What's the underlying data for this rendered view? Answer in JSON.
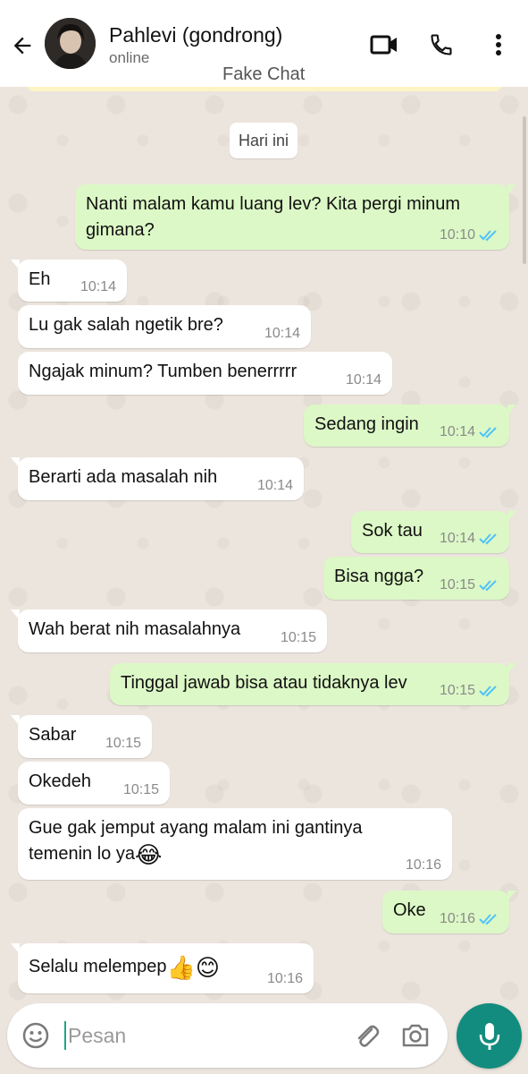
{
  "header": {
    "contact_name": "Pahlevi (gondrong)",
    "status": "online",
    "watermark": "Fake Chat",
    "icons": [
      "back-arrow-icon",
      "video-call-icon",
      "phone-icon",
      "more-vert-icon"
    ]
  },
  "chat": {
    "date_chip": "Hari ini",
    "messages": [
      {
        "dir": "out",
        "line1": "Nanti malam kamu luang lev? Kita pergi minum",
        "line2": "gimana?",
        "time": "10:10",
        "read": true
      },
      {
        "dir": "in",
        "text": "Eh",
        "time": "10:14"
      },
      {
        "dir": "in",
        "text": "Lu gak salah ngetik bre?",
        "time": "10:14"
      },
      {
        "dir": "in",
        "text": "Ngajak minum? Tumben benerrrrr",
        "time": "10:14"
      },
      {
        "dir": "out",
        "text": "Sedang ingin",
        "time": "10:14",
        "read": true
      },
      {
        "dir": "in",
        "text": "Berarti ada masalah nih",
        "time": "10:14"
      },
      {
        "dir": "out",
        "text": "Sok tau",
        "time": "10:14",
        "read": true
      },
      {
        "dir": "out",
        "text": "Bisa ngga?",
        "time": "10:15",
        "read": true
      },
      {
        "dir": "in",
        "text": "Wah berat nih masalahnya",
        "time": "10:15"
      },
      {
        "dir": "out",
        "text": "Tinggal jawab bisa atau tidaknya lev",
        "time": "10:15",
        "read": true
      },
      {
        "dir": "in",
        "text": "Sabar",
        "time": "10:15"
      },
      {
        "dir": "in",
        "text": "Okedeh",
        "time": "10:15"
      },
      {
        "dir": "in",
        "line1": "Gue gak jemput ayang malam ini gantinya",
        "line2": "temenin lo ya",
        "emoji": "😂",
        "time": "10:16"
      },
      {
        "dir": "out",
        "text": "Oke",
        "time": "10:16",
        "read": true
      },
      {
        "dir": "in",
        "text": "Selalu melempep",
        "emoji": "👍😊",
        "time": "10:16"
      }
    ]
  },
  "composer": {
    "placeholder": "Pesan",
    "icons": [
      "emoji-icon",
      "attach-icon",
      "camera-icon",
      "mic-icon"
    ]
  },
  "colors": {
    "outgoing_bubble": "#dcf8c6",
    "incoming_bubble": "#ffffff",
    "chat_background": "#ece5dd",
    "read_tick": "#4fc3f7",
    "mic_button": "#128c7e"
  }
}
